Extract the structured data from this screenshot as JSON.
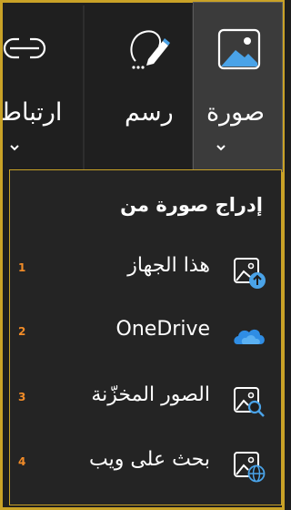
{
  "ribbon": {
    "picture": {
      "label": "صورة",
      "icon": "picture-icon"
    },
    "draw": {
      "label": "رسم",
      "icon": "draw-icon"
    },
    "link": {
      "label": "ارتباط",
      "icon": "link-icon"
    }
  },
  "dropdown": {
    "title": "إدراج صورة من",
    "items": [
      {
        "label": "هذا الجهاز",
        "key": "1",
        "icon": "picture-upload-icon"
      },
      {
        "label": "OneDrive",
        "key": "2",
        "icon": "onedrive-cloud-icon"
      },
      {
        "label": "الصور المخزّنة",
        "key": "3",
        "icon": "picture-search-icon"
      },
      {
        "label": "بحث على ويب",
        "key": "4",
        "icon": "picture-web-icon"
      }
    ]
  },
  "colors": {
    "accent_border": "#c9a227",
    "key_tip": "#f28c28",
    "icon_blue": "#4aa3e8"
  }
}
